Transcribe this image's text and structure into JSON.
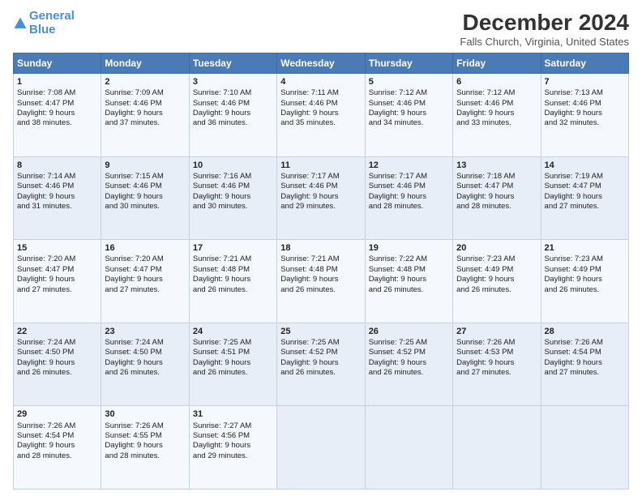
{
  "header": {
    "logo_line1": "General",
    "logo_line2": "Blue",
    "title": "December 2024",
    "subtitle": "Falls Church, Virginia, United States"
  },
  "days_header": [
    "Sunday",
    "Monday",
    "Tuesday",
    "Wednesday",
    "Thursday",
    "Friday",
    "Saturday"
  ],
  "weeks": [
    [
      {
        "day": "1",
        "info": "Sunrise: 7:08 AM\nSunset: 4:47 PM\nDaylight: 9 hours\nand 38 minutes."
      },
      {
        "day": "2",
        "info": "Sunrise: 7:09 AM\nSunset: 4:46 PM\nDaylight: 9 hours\nand 37 minutes."
      },
      {
        "day": "3",
        "info": "Sunrise: 7:10 AM\nSunset: 4:46 PM\nDaylight: 9 hours\nand 36 minutes."
      },
      {
        "day": "4",
        "info": "Sunrise: 7:11 AM\nSunset: 4:46 PM\nDaylight: 9 hours\nand 35 minutes."
      },
      {
        "day": "5",
        "info": "Sunrise: 7:12 AM\nSunset: 4:46 PM\nDaylight: 9 hours\nand 34 minutes."
      },
      {
        "day": "6",
        "info": "Sunrise: 7:12 AM\nSunset: 4:46 PM\nDaylight: 9 hours\nand 33 minutes."
      },
      {
        "day": "7",
        "info": "Sunrise: 7:13 AM\nSunset: 4:46 PM\nDaylight: 9 hours\nand 32 minutes."
      }
    ],
    [
      {
        "day": "8",
        "info": "Sunrise: 7:14 AM\nSunset: 4:46 PM\nDaylight: 9 hours\nand 31 minutes."
      },
      {
        "day": "9",
        "info": "Sunrise: 7:15 AM\nSunset: 4:46 PM\nDaylight: 9 hours\nand 30 minutes."
      },
      {
        "day": "10",
        "info": "Sunrise: 7:16 AM\nSunset: 4:46 PM\nDaylight: 9 hours\nand 30 minutes."
      },
      {
        "day": "11",
        "info": "Sunrise: 7:17 AM\nSunset: 4:46 PM\nDaylight: 9 hours\nand 29 minutes."
      },
      {
        "day": "12",
        "info": "Sunrise: 7:17 AM\nSunset: 4:46 PM\nDaylight: 9 hours\nand 28 minutes."
      },
      {
        "day": "13",
        "info": "Sunrise: 7:18 AM\nSunset: 4:47 PM\nDaylight: 9 hours\nand 28 minutes."
      },
      {
        "day": "14",
        "info": "Sunrise: 7:19 AM\nSunset: 4:47 PM\nDaylight: 9 hours\nand 27 minutes."
      }
    ],
    [
      {
        "day": "15",
        "info": "Sunrise: 7:20 AM\nSunset: 4:47 PM\nDaylight: 9 hours\nand 27 minutes."
      },
      {
        "day": "16",
        "info": "Sunrise: 7:20 AM\nSunset: 4:47 PM\nDaylight: 9 hours\nand 27 minutes."
      },
      {
        "day": "17",
        "info": "Sunrise: 7:21 AM\nSunset: 4:48 PM\nDaylight: 9 hours\nand 26 minutes."
      },
      {
        "day": "18",
        "info": "Sunrise: 7:21 AM\nSunset: 4:48 PM\nDaylight: 9 hours\nand 26 minutes."
      },
      {
        "day": "19",
        "info": "Sunrise: 7:22 AM\nSunset: 4:48 PM\nDaylight: 9 hours\nand 26 minutes."
      },
      {
        "day": "20",
        "info": "Sunrise: 7:23 AM\nSunset: 4:49 PM\nDaylight: 9 hours\nand 26 minutes."
      },
      {
        "day": "21",
        "info": "Sunrise: 7:23 AM\nSunset: 4:49 PM\nDaylight: 9 hours\nand 26 minutes."
      }
    ],
    [
      {
        "day": "22",
        "info": "Sunrise: 7:24 AM\nSunset: 4:50 PM\nDaylight: 9 hours\nand 26 minutes."
      },
      {
        "day": "23",
        "info": "Sunrise: 7:24 AM\nSunset: 4:50 PM\nDaylight: 9 hours\nand 26 minutes."
      },
      {
        "day": "24",
        "info": "Sunrise: 7:25 AM\nSunset: 4:51 PM\nDaylight: 9 hours\nand 26 minutes."
      },
      {
        "day": "25",
        "info": "Sunrise: 7:25 AM\nSunset: 4:52 PM\nDaylight: 9 hours\nand 26 minutes."
      },
      {
        "day": "26",
        "info": "Sunrise: 7:25 AM\nSunset: 4:52 PM\nDaylight: 9 hours\nand 26 minutes."
      },
      {
        "day": "27",
        "info": "Sunrise: 7:26 AM\nSunset: 4:53 PM\nDaylight: 9 hours\nand 27 minutes."
      },
      {
        "day": "28",
        "info": "Sunrise: 7:26 AM\nSunset: 4:54 PM\nDaylight: 9 hours\nand 27 minutes."
      }
    ],
    [
      {
        "day": "29",
        "info": "Sunrise: 7:26 AM\nSunset: 4:54 PM\nDaylight: 9 hours\nand 28 minutes."
      },
      {
        "day": "30",
        "info": "Sunrise: 7:26 AM\nSunset: 4:55 PM\nDaylight: 9 hours\nand 28 minutes."
      },
      {
        "day": "31",
        "info": "Sunrise: 7:27 AM\nSunset: 4:56 PM\nDaylight: 9 hours\nand 29 minutes."
      },
      {
        "day": "",
        "info": ""
      },
      {
        "day": "",
        "info": ""
      },
      {
        "day": "",
        "info": ""
      },
      {
        "day": "",
        "info": ""
      }
    ]
  ]
}
